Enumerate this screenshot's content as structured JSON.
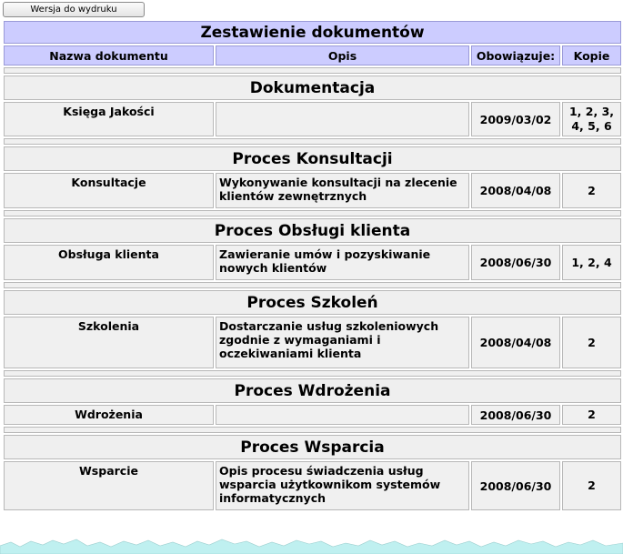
{
  "print_button": "Wersja do wydruku",
  "title": "Zestawienie dokumentów",
  "columns": {
    "name": "Nazwa dokumentu",
    "desc": "Opis",
    "date": "Obowiązuje:",
    "copies": "Kopie"
  },
  "groups": [
    {
      "title": "Dokumentacja",
      "rows": [
        {
          "name": "Księga Jakości",
          "desc": "",
          "date": "2009/03/02",
          "copies": "1, 2, 3, 4, 5, 6"
        }
      ]
    },
    {
      "title": "Proces Konsultacji",
      "rows": [
        {
          "name": "Konsultacje",
          "desc": "Wykonywanie konsultacji na zlecenie klientów zewnętrznych",
          "date": "2008/04/08",
          "copies": "2"
        }
      ]
    },
    {
      "title": "Proces Obsługi klienta",
      "rows": [
        {
          "name": "Obsługa klienta",
          "desc": "Zawieranie umów i pozyskiwanie nowych klientów",
          "date": "2008/06/30",
          "copies": "1, 2, 4"
        }
      ]
    },
    {
      "title": "Proces Szkoleń",
      "rows": [
        {
          "name": "Szkolenia",
          "desc": "Dostarczanie usług szkoleniowych zgodnie z wymaganiami i oczekiwaniami klienta",
          "date": "2008/04/08",
          "copies": "2"
        }
      ]
    },
    {
      "title": "Proces Wdrożenia",
      "rows": [
        {
          "name": "Wdrożenia",
          "desc": "",
          "date": "2008/06/30",
          "copies": "2"
        }
      ]
    },
    {
      "title": "Proces Wsparcia",
      "rows": [
        {
          "name": "Wsparcie",
          "desc": "Opis procesu świadczenia usług wsparcia użytkownikom systemów informatycznych",
          "date": "2008/06/30",
          "copies": "2"
        }
      ]
    }
  ],
  "colors": {
    "header_bg": "#ccccff",
    "cell_bg": "#f0f0f0",
    "torn_edge": "#bff0f0"
  }
}
